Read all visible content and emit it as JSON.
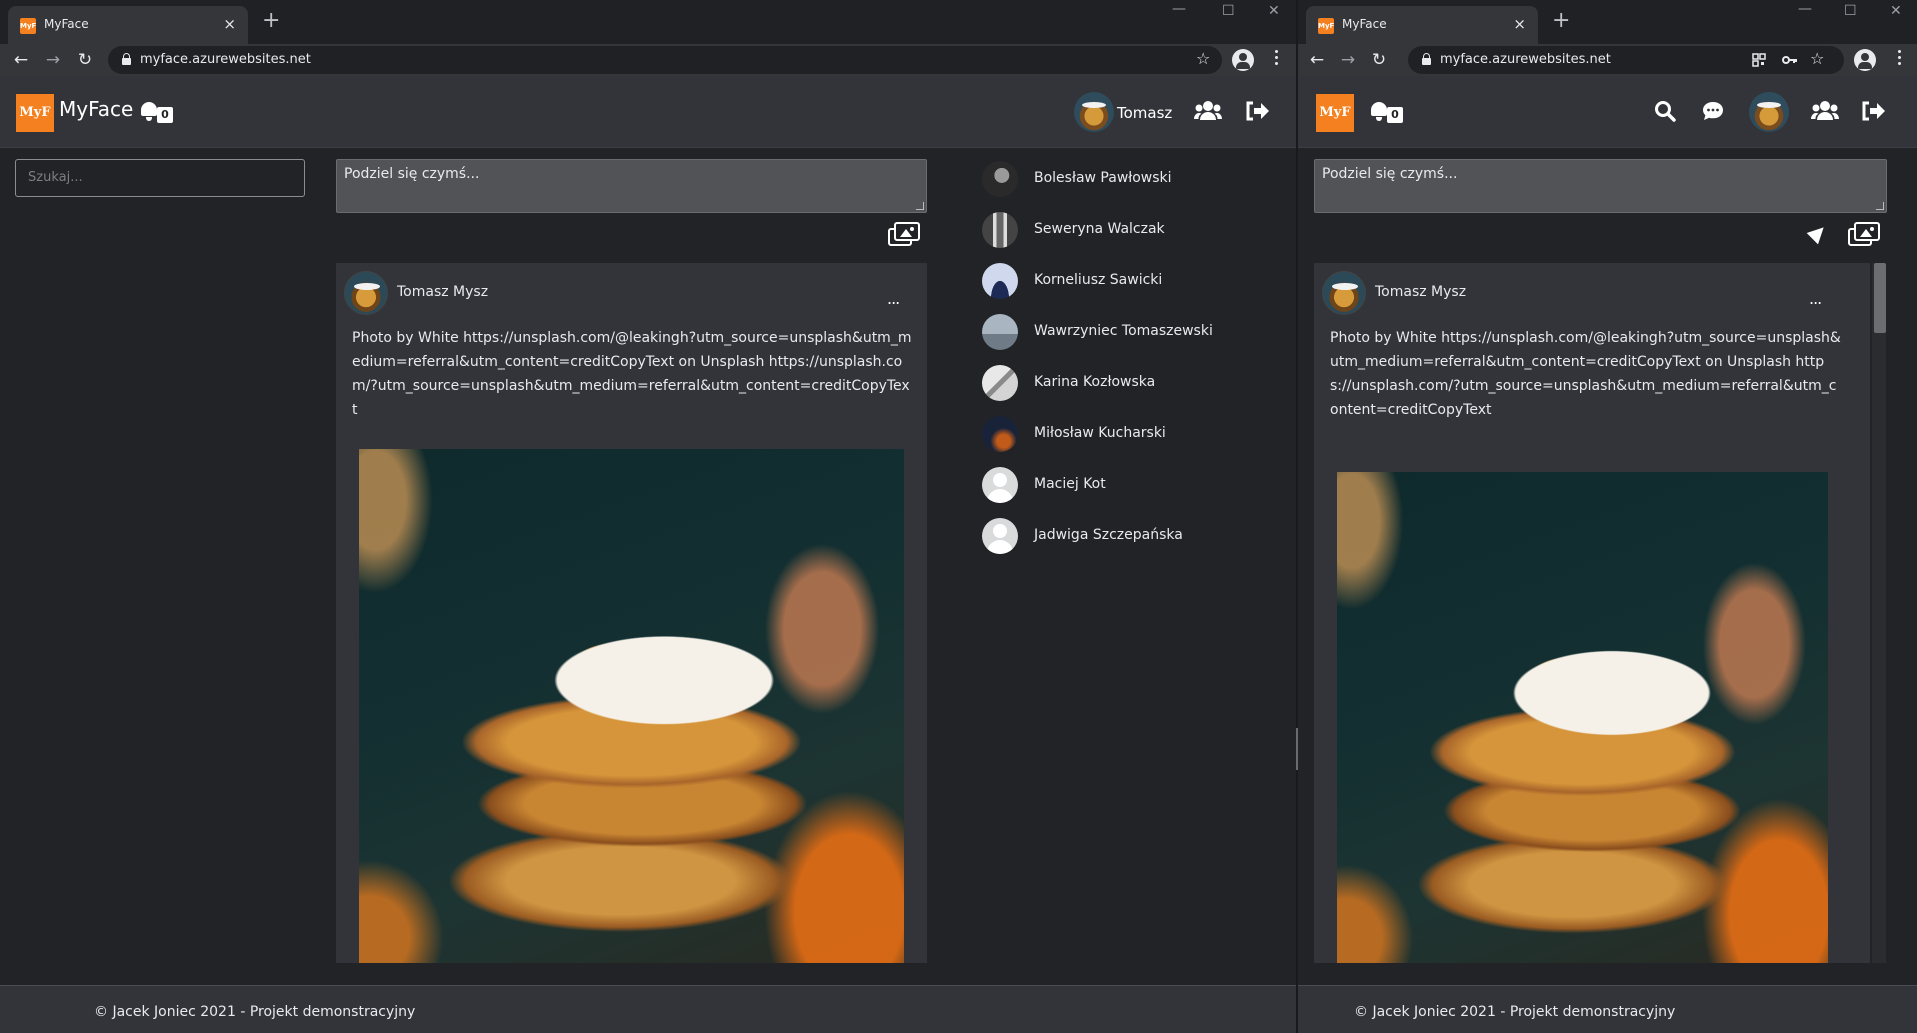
{
  "left_window": {
    "tab_title": "MyFace",
    "favicon_text": "MyF",
    "url": "myface.azurewebsites.net",
    "app": {
      "logo_text": "MyF",
      "brand": "MyFace",
      "notifications_count": "0",
      "user_name": "Tomasz",
      "search_placeholder": "Szukaj...",
      "composer_placeholder": "Podziel się czymś...",
      "post": {
        "author": "Tomasz Mysz",
        "menu": "...",
        "text": "Photo by White https://unsplash.com/@leakingh?utm_source=unsplash&utm_medium=referral&utm_content=creditCopyText on Unsplash https://unsplash.com/?utm_source=unsplash&utm_medium=referral&utm_content=creditCopyText"
      },
      "friends": [
        {
          "name": "Bolesław Pawłowski",
          "avatar": "photo-dark"
        },
        {
          "name": "Seweryna Walczak",
          "avatar": "photo-gray"
        },
        {
          "name": "Korneliusz Sawicki",
          "avatar": "photo-blue"
        },
        {
          "name": "Wawrzyniec Tomaszewski",
          "avatar": "photo-sky"
        },
        {
          "name": "Karina Kozłowska",
          "avatar": "photo-light"
        },
        {
          "name": "Miłosław Kucharski",
          "avatar": "photo-night"
        },
        {
          "name": "Maciej Kot",
          "avatar": "placeholder"
        },
        {
          "name": "Jadwiga Szczepańska",
          "avatar": "placeholder"
        }
      ],
      "footer": "© Jacek Joniec 2021 - Projekt demonstracyjny"
    }
  },
  "right_window": {
    "tab_title": "MyFace",
    "favicon_text": "MyF",
    "url": "myface.azurewebsites.net",
    "app": {
      "logo_text": "MyF",
      "notifications_count": "0",
      "composer_placeholder": "Podziel się czymś...",
      "post": {
        "author": "Tomasz Mysz",
        "menu": "...",
        "text": "Photo by White https://unsplash.com/@leakingh?utm_source=unsplash&utm_medium=referral&utm_content=creditCopyText on Unsplash https://unsplash.com/?utm_source=unsplash&utm_medium=referral&utm_content=creditCopyText"
      },
      "footer": "© Jacek Joniec 2021 - Projekt demonstracyjny"
    }
  },
  "browser": {
    "new_tab": "+",
    "close_tab": "×",
    "minimize": "—",
    "maximize": "☐",
    "close_window": "✕",
    "back": "←",
    "forward": "→",
    "reload": "↻",
    "bookmark_star": "☆"
  },
  "icons": {
    "bell": "bell-icon",
    "friends": "users-icon",
    "logout": "sign-out-icon",
    "search": "search-icon",
    "chat": "comment-icon",
    "images": "images-icon",
    "send": "location-arrow-icon"
  },
  "colors": {
    "brand_orange": "#f4801f",
    "app_bg": "#222326",
    "navbar_bg": "#323439",
    "chrome_bg": "#202124",
    "chrome_toolbar": "#35363a"
  }
}
